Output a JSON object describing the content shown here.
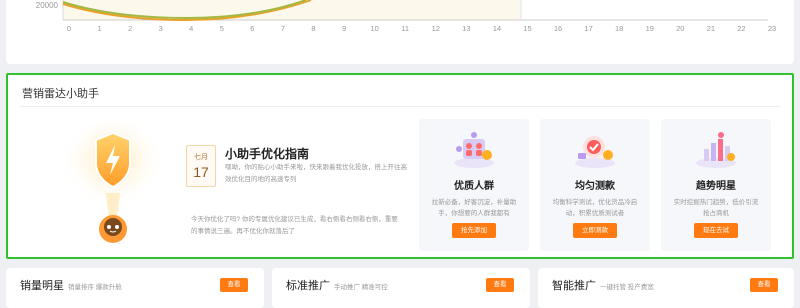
{
  "chart": {
    "y_tick": "20000",
    "x_ticks": [
      "0",
      "1",
      "2",
      "3",
      "4",
      "5",
      "6",
      "7",
      "8",
      "9",
      "10",
      "11",
      "12",
      "13",
      "14",
      "15",
      "16",
      "17",
      "18",
      "19",
      "20",
      "21",
      "22",
      "23"
    ]
  },
  "assistant": {
    "title": "营销雷达小助手",
    "date_month": "七月",
    "date_day": "17",
    "guide_title": "小助手优化指南",
    "guide_desc": "嘿呦，你的贴心小助手来啦，快来跟着我优化投放，搭上开往高效优化目的地的高速专列",
    "guide_foot": "今天你优化了吗? 你的专属优化建议已生成，看右侧看右侧看右侧，重要的事情说三遍。再不优化你就落后了",
    "features": [
      {
        "title": "优质人群",
        "desc": "拉新必备，好客沉淀，补量助手，你想要的人群我都有",
        "button": "抢先添加"
      },
      {
        "title": "均匀测款",
        "desc": "均衡科学测试，优化货品冷启动，积累优质测试者",
        "button": "立即测款"
      },
      {
        "title": "趋势明星",
        "desc": "实时挖掘热门趋势，低价引流抢占商机",
        "button": "现在去试"
      }
    ]
  },
  "bottom_cards": [
    {
      "title": "销量明星",
      "sub": "销量排序 爆款升舱",
      "button": "查看"
    },
    {
      "title": "标准推广",
      "sub": "手动推广 精准可控",
      "button": "查看"
    },
    {
      "title": "智能推广",
      "sub": "一键托管 投产费宽",
      "button": "查看"
    }
  ],
  "colors": {
    "accent": "#ff7a10",
    "highlight_border": "#2fc22f"
  }
}
